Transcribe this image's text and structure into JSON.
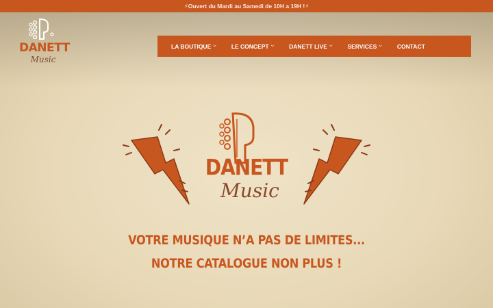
{
  "announcement": {
    "text": "⚡Ouvert du Mardi au Samedi de 10H a 19H !⚡"
  },
  "header": {
    "logo": {
      "brand": "DANETT",
      "script": "Music"
    }
  },
  "nav": {
    "items": [
      {
        "label": "LA BOUTIQUE",
        "has_dropdown": true
      },
      {
        "label": "LE CONCEPT",
        "has_dropdown": true
      },
      {
        "label": "DANETT LIVE",
        "has_dropdown": true
      },
      {
        "label": "SERVICES",
        "has_dropdown": true
      },
      {
        "label": "CONTACT",
        "has_dropdown": false
      }
    ],
    "chevron": "⌵"
  },
  "hero": {
    "logo": {
      "brand": "DANETT",
      "script": "Music"
    },
    "tagline_line1": "VOTRE MUSIQUE N’A PAS DE LIMITES...",
    "tagline_line2": "NOTRE CATALOGUE NON PLUS !"
  },
  "colors": {
    "accent": "#c8561f",
    "paper": "#efe3c7",
    "script": "#8a4a2a"
  },
  "icons": [
    "guitar-headstock-icon",
    "lightning-bolt-icon",
    "chevron-down-icon"
  ]
}
